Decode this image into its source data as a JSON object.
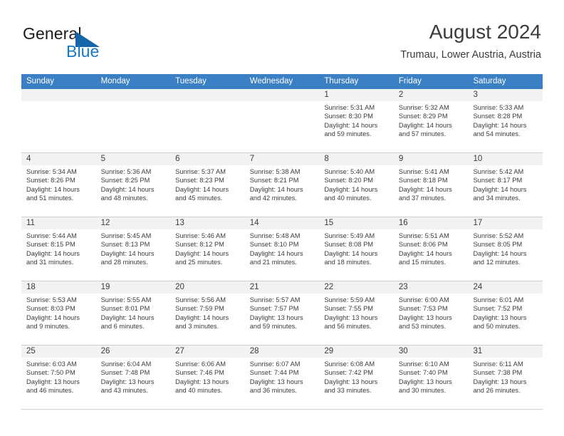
{
  "brand": {
    "name_part1": "General",
    "name_part2": "Blue",
    "flag_icon": "triangle-flag-icon"
  },
  "header": {
    "title": "August 2024",
    "subtitle": "Trumau, Lower Austria, Austria"
  },
  "colors": {
    "header_blue": "#3b7fc4",
    "brand_blue": "#1878c8",
    "daynum_band": "#f2f2f2",
    "row_divider": "#cfcfcf",
    "text": "#3c3c3c"
  },
  "weekday_headers": [
    "Sunday",
    "Monday",
    "Tuesday",
    "Wednesday",
    "Thursday",
    "Friday",
    "Saturday"
  ],
  "weeks": [
    [
      {
        "day": "",
        "sunrise": "",
        "sunset": "",
        "daylight_line1": "",
        "daylight_line2": ""
      },
      {
        "day": "",
        "sunrise": "",
        "sunset": "",
        "daylight_line1": "",
        "daylight_line2": ""
      },
      {
        "day": "",
        "sunrise": "",
        "sunset": "",
        "daylight_line1": "",
        "daylight_line2": ""
      },
      {
        "day": "",
        "sunrise": "",
        "sunset": "",
        "daylight_line1": "",
        "daylight_line2": ""
      },
      {
        "day": "1",
        "sunrise": "Sunrise: 5:31 AM",
        "sunset": "Sunset: 8:30 PM",
        "daylight_line1": "Daylight: 14 hours",
        "daylight_line2": "and 59 minutes."
      },
      {
        "day": "2",
        "sunrise": "Sunrise: 5:32 AM",
        "sunset": "Sunset: 8:29 PM",
        "daylight_line1": "Daylight: 14 hours",
        "daylight_line2": "and 57 minutes."
      },
      {
        "day": "3",
        "sunrise": "Sunrise: 5:33 AM",
        "sunset": "Sunset: 8:28 PM",
        "daylight_line1": "Daylight: 14 hours",
        "daylight_line2": "and 54 minutes."
      }
    ],
    [
      {
        "day": "4",
        "sunrise": "Sunrise: 5:34 AM",
        "sunset": "Sunset: 8:26 PM",
        "daylight_line1": "Daylight: 14 hours",
        "daylight_line2": "and 51 minutes."
      },
      {
        "day": "5",
        "sunrise": "Sunrise: 5:36 AM",
        "sunset": "Sunset: 8:25 PM",
        "daylight_line1": "Daylight: 14 hours",
        "daylight_line2": "and 48 minutes."
      },
      {
        "day": "6",
        "sunrise": "Sunrise: 5:37 AM",
        "sunset": "Sunset: 8:23 PM",
        "daylight_line1": "Daylight: 14 hours",
        "daylight_line2": "and 45 minutes."
      },
      {
        "day": "7",
        "sunrise": "Sunrise: 5:38 AM",
        "sunset": "Sunset: 8:21 PM",
        "daylight_line1": "Daylight: 14 hours",
        "daylight_line2": "and 42 minutes."
      },
      {
        "day": "8",
        "sunrise": "Sunrise: 5:40 AM",
        "sunset": "Sunset: 8:20 PM",
        "daylight_line1": "Daylight: 14 hours",
        "daylight_line2": "and 40 minutes."
      },
      {
        "day": "9",
        "sunrise": "Sunrise: 5:41 AM",
        "sunset": "Sunset: 8:18 PM",
        "daylight_line1": "Daylight: 14 hours",
        "daylight_line2": "and 37 minutes."
      },
      {
        "day": "10",
        "sunrise": "Sunrise: 5:42 AM",
        "sunset": "Sunset: 8:17 PM",
        "daylight_line1": "Daylight: 14 hours",
        "daylight_line2": "and 34 minutes."
      }
    ],
    [
      {
        "day": "11",
        "sunrise": "Sunrise: 5:44 AM",
        "sunset": "Sunset: 8:15 PM",
        "daylight_line1": "Daylight: 14 hours",
        "daylight_line2": "and 31 minutes."
      },
      {
        "day": "12",
        "sunrise": "Sunrise: 5:45 AM",
        "sunset": "Sunset: 8:13 PM",
        "daylight_line1": "Daylight: 14 hours",
        "daylight_line2": "and 28 minutes."
      },
      {
        "day": "13",
        "sunrise": "Sunrise: 5:46 AM",
        "sunset": "Sunset: 8:12 PM",
        "daylight_line1": "Daylight: 14 hours",
        "daylight_line2": "and 25 minutes."
      },
      {
        "day": "14",
        "sunrise": "Sunrise: 5:48 AM",
        "sunset": "Sunset: 8:10 PM",
        "daylight_line1": "Daylight: 14 hours",
        "daylight_line2": "and 21 minutes."
      },
      {
        "day": "15",
        "sunrise": "Sunrise: 5:49 AM",
        "sunset": "Sunset: 8:08 PM",
        "daylight_line1": "Daylight: 14 hours",
        "daylight_line2": "and 18 minutes."
      },
      {
        "day": "16",
        "sunrise": "Sunrise: 5:51 AM",
        "sunset": "Sunset: 8:06 PM",
        "daylight_line1": "Daylight: 14 hours",
        "daylight_line2": "and 15 minutes."
      },
      {
        "day": "17",
        "sunrise": "Sunrise: 5:52 AM",
        "sunset": "Sunset: 8:05 PM",
        "daylight_line1": "Daylight: 14 hours",
        "daylight_line2": "and 12 minutes."
      }
    ],
    [
      {
        "day": "18",
        "sunrise": "Sunrise: 5:53 AM",
        "sunset": "Sunset: 8:03 PM",
        "daylight_line1": "Daylight: 14 hours",
        "daylight_line2": "and 9 minutes."
      },
      {
        "day": "19",
        "sunrise": "Sunrise: 5:55 AM",
        "sunset": "Sunset: 8:01 PM",
        "daylight_line1": "Daylight: 14 hours",
        "daylight_line2": "and 6 minutes."
      },
      {
        "day": "20",
        "sunrise": "Sunrise: 5:56 AM",
        "sunset": "Sunset: 7:59 PM",
        "daylight_line1": "Daylight: 14 hours",
        "daylight_line2": "and 3 minutes."
      },
      {
        "day": "21",
        "sunrise": "Sunrise: 5:57 AM",
        "sunset": "Sunset: 7:57 PM",
        "daylight_line1": "Daylight: 13 hours",
        "daylight_line2": "and 59 minutes."
      },
      {
        "day": "22",
        "sunrise": "Sunrise: 5:59 AM",
        "sunset": "Sunset: 7:55 PM",
        "daylight_line1": "Daylight: 13 hours",
        "daylight_line2": "and 56 minutes."
      },
      {
        "day": "23",
        "sunrise": "Sunrise: 6:00 AM",
        "sunset": "Sunset: 7:53 PM",
        "daylight_line1": "Daylight: 13 hours",
        "daylight_line2": "and 53 minutes."
      },
      {
        "day": "24",
        "sunrise": "Sunrise: 6:01 AM",
        "sunset": "Sunset: 7:52 PM",
        "daylight_line1": "Daylight: 13 hours",
        "daylight_line2": "and 50 minutes."
      }
    ],
    [
      {
        "day": "25",
        "sunrise": "Sunrise: 6:03 AM",
        "sunset": "Sunset: 7:50 PM",
        "daylight_line1": "Daylight: 13 hours",
        "daylight_line2": "and 46 minutes."
      },
      {
        "day": "26",
        "sunrise": "Sunrise: 6:04 AM",
        "sunset": "Sunset: 7:48 PM",
        "daylight_line1": "Daylight: 13 hours",
        "daylight_line2": "and 43 minutes."
      },
      {
        "day": "27",
        "sunrise": "Sunrise: 6:06 AM",
        "sunset": "Sunset: 7:46 PM",
        "daylight_line1": "Daylight: 13 hours",
        "daylight_line2": "and 40 minutes."
      },
      {
        "day": "28",
        "sunrise": "Sunrise: 6:07 AM",
        "sunset": "Sunset: 7:44 PM",
        "daylight_line1": "Daylight: 13 hours",
        "daylight_line2": "and 36 minutes."
      },
      {
        "day": "29",
        "sunrise": "Sunrise: 6:08 AM",
        "sunset": "Sunset: 7:42 PM",
        "daylight_line1": "Daylight: 13 hours",
        "daylight_line2": "and 33 minutes."
      },
      {
        "day": "30",
        "sunrise": "Sunrise: 6:10 AM",
        "sunset": "Sunset: 7:40 PM",
        "daylight_line1": "Daylight: 13 hours",
        "daylight_line2": "and 30 minutes."
      },
      {
        "day": "31",
        "sunrise": "Sunrise: 6:11 AM",
        "sunset": "Sunset: 7:38 PM",
        "daylight_line1": "Daylight: 13 hours",
        "daylight_line2": "and 26 minutes."
      }
    ]
  ]
}
